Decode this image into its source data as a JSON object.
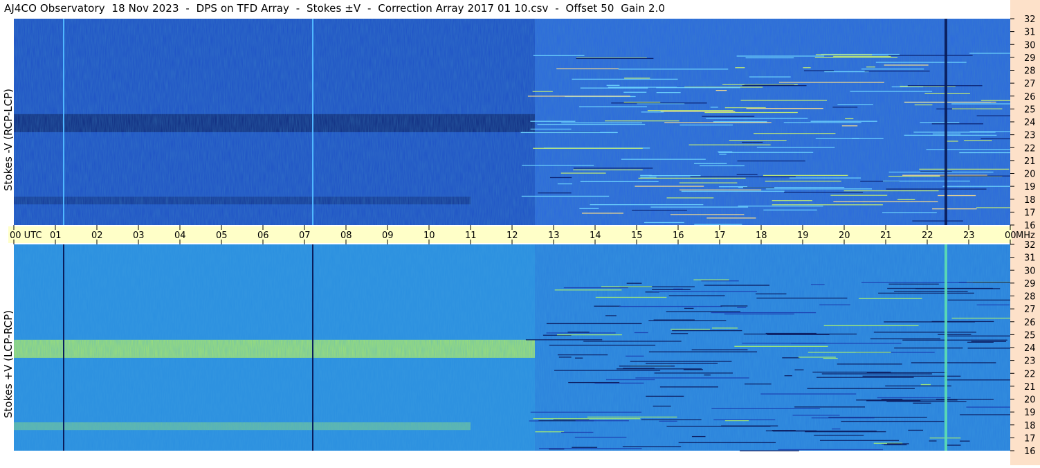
{
  "title": "AJ4CO Observatory  18 Nov 2023  -  DPS on TFD Array  -  Stokes ±V  -  Correction Array 2017 01 10.csv  -  Offset 50  Gain 2.0",
  "colors": {
    "upper_base": "#1d4fc7",
    "upper_dark": "#0a1f6e",
    "lower_base": "#2a8fe0",
    "lower_bright": "#b4f060",
    "axis_band": "#ffffc8",
    "right_band": "#fde1c9"
  },
  "chart_data": [
    {
      "type": "heatmap",
      "ylabel": "Stokes -V (RCP-LCP)",
      "xlabel": "",
      "x_ticks": [
        "00  UTC",
        "01",
        "02",
        "03",
        "04",
        "05",
        "06",
        "07",
        "08",
        "09",
        "10",
        "11",
        "12",
        "13",
        "14",
        "15",
        "16",
        "17",
        "18",
        "19",
        "20",
        "21",
        "22",
        "23",
        "00"
      ],
      "x_unit": "MHz",
      "xlim": [
        0,
        24
      ],
      "ylim": [
        16,
        32
      ],
      "y_ticks": [
        32,
        31,
        30,
        29,
        28,
        27,
        26,
        25,
        24,
        23,
        22,
        21,
        20,
        19,
        18,
        17,
        16
      ],
      "features": {
        "dark_band_mhz": [
          23.2,
          24.6
        ],
        "dark_band_end_hour": 12.55,
        "vertical_lines_hours": [
          1.2,
          7.2
        ],
        "dark_vertical_hour": 22.45
      }
    },
    {
      "type": "heatmap",
      "ylabel": "Stokes +V (LCP-RCP)",
      "xlabel": "",
      "xlim": [
        0,
        24
      ],
      "ylim": [
        16,
        32
      ],
      "y_ticks": [
        32,
        31,
        30,
        29,
        28,
        27,
        26,
        25,
        24,
        23,
        22,
        21,
        20,
        19,
        18,
        17,
        16
      ],
      "features": {
        "bright_band_mhz": [
          23.2,
          24.6
        ],
        "bright_band_end_hour": 12.55,
        "vertical_lines_hours": [
          1.2,
          7.2
        ],
        "bright_vertical_hour": 22.45
      }
    }
  ]
}
